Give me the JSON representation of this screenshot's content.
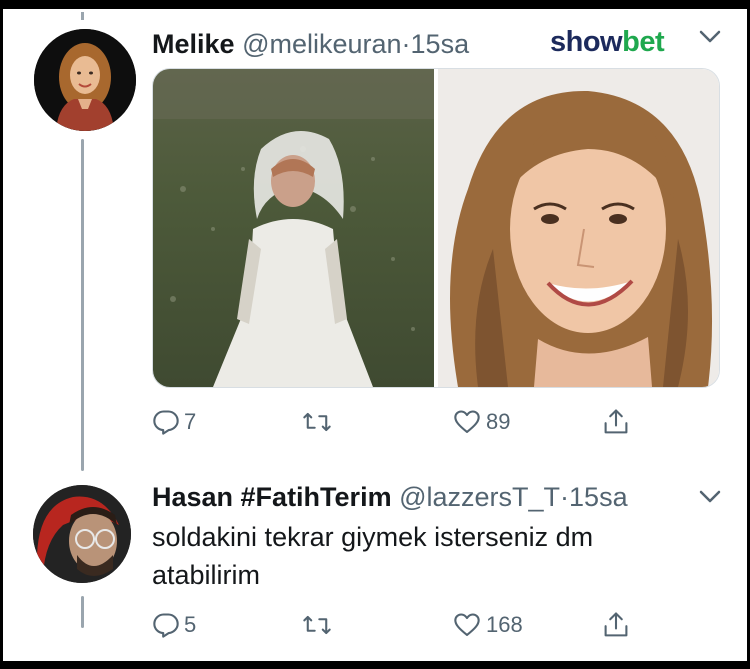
{
  "tweet1": {
    "name": "Melike",
    "handle": "@melikeuran",
    "separator": "·",
    "time": "15sa",
    "replies": "7",
    "likes": "89"
  },
  "watermark": {
    "show": "show",
    "bet": "bet"
  },
  "tweet2": {
    "name": "Hasan #FatihTerim",
    "handle": "@lazzersT_T",
    "separator": "·",
    "time": "15sa",
    "text": "soldakini tekrar giymek isterseniz dm atabilirim",
    "replies": "5",
    "likes": "168"
  },
  "colors": {
    "text": "#14171a",
    "secondary": "#536471",
    "thread_line": "#9aa5ae",
    "watermark_navy": "#1c2a5c",
    "watermark_green": "#1fa84e"
  },
  "icons": [
    "reply-icon",
    "retweet-icon",
    "like-icon",
    "share-icon",
    "chevron-down-icon"
  ]
}
